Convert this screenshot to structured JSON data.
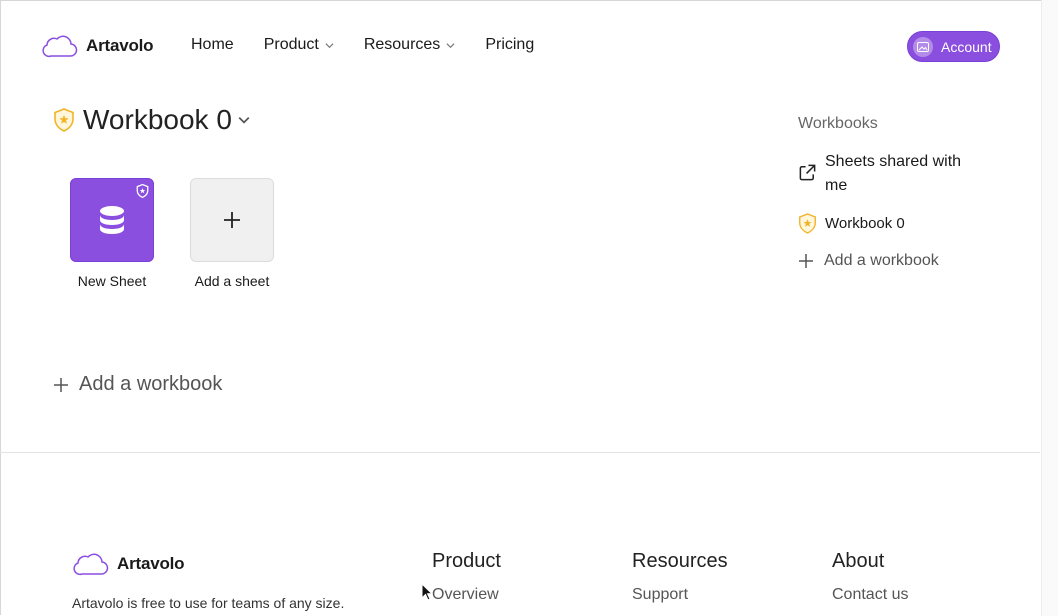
{
  "brand": {
    "name": "Artavolo"
  },
  "nav": {
    "items": [
      {
        "label": "Home",
        "dropdown": false
      },
      {
        "label": "Product",
        "dropdown": true
      },
      {
        "label": "Resources",
        "dropdown": true
      },
      {
        "label": "Pricing",
        "dropdown": false
      }
    ]
  },
  "account": {
    "label": "Account"
  },
  "workbook": {
    "title": "Workbook 0",
    "sheets": [
      {
        "label": "New Sheet"
      }
    ],
    "add_sheet_label": "Add a sheet",
    "add_workbook_label": "Add a workbook"
  },
  "sidebar": {
    "heading": "Workbooks",
    "shared_label": "Sheets shared with me",
    "workbooks": [
      {
        "label": "Workbook 0"
      }
    ],
    "add_workbook_label": "Add a workbook"
  },
  "footer": {
    "brand_name": "Artavolo",
    "description": "Artavolo is free to use for teams of any size.",
    "columns": [
      {
        "heading": "Product",
        "links": [
          "Overview"
        ]
      },
      {
        "heading": "Resources",
        "links": [
          "Support"
        ]
      },
      {
        "heading": "About",
        "links": [
          "Contact us"
        ]
      }
    ]
  },
  "colors": {
    "accent": "#8b4fe0",
    "shield": "#f0b429",
    "divider": "#e3e3e3"
  }
}
